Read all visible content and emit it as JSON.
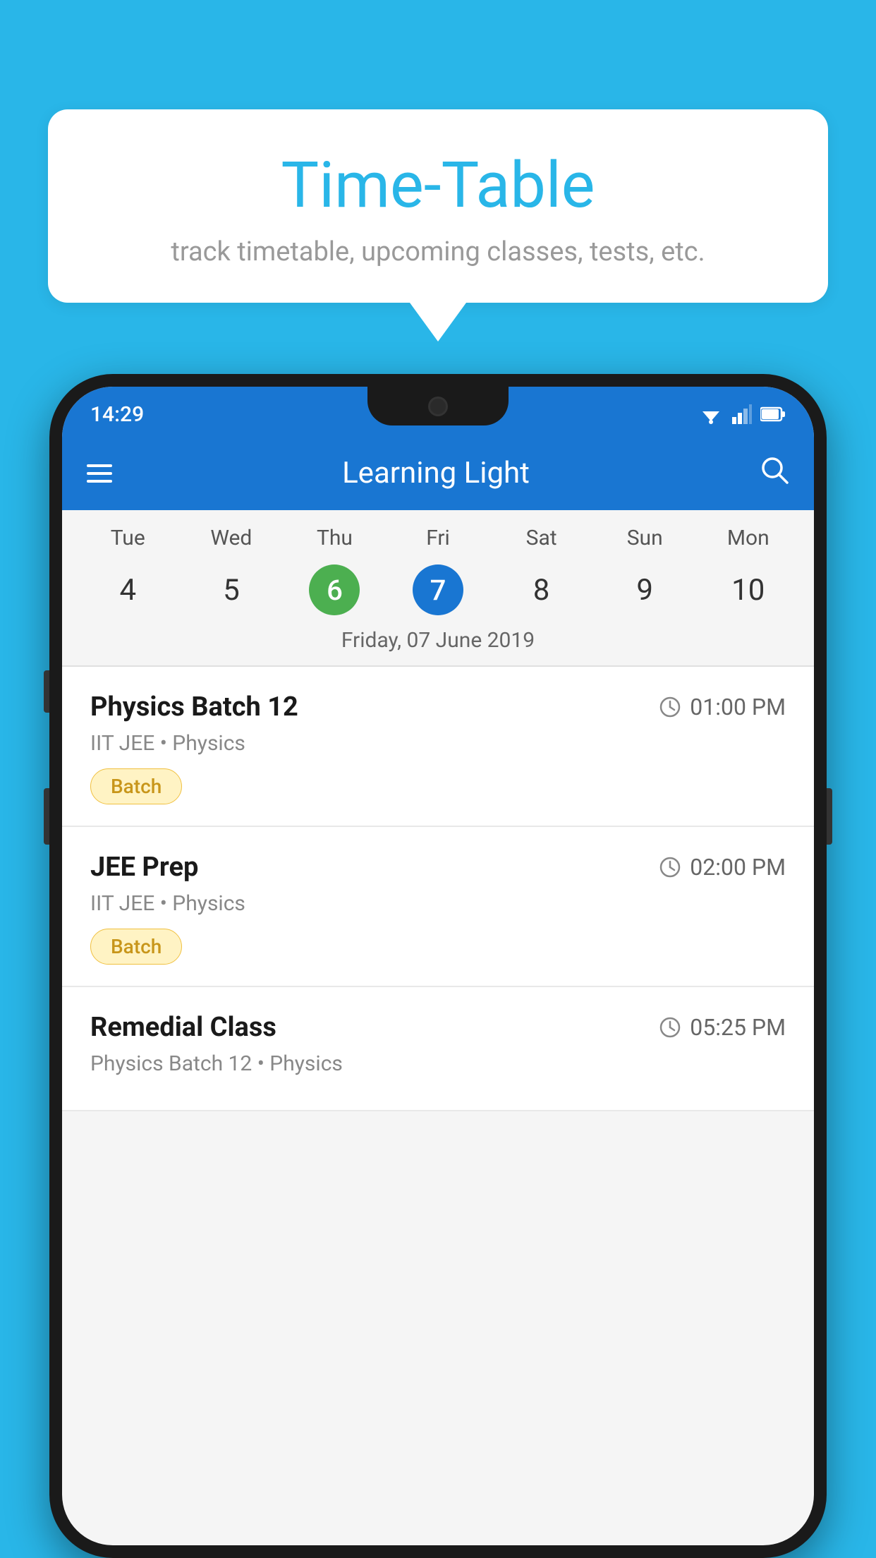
{
  "background_color": "#29B6E8",
  "bubble": {
    "title": "Time-Table",
    "subtitle": "track timetable, upcoming classes, tests, etc."
  },
  "phone": {
    "status_bar": {
      "time": "14:29"
    },
    "app_bar": {
      "title": "Learning Light"
    },
    "calendar": {
      "days": [
        "Tue",
        "Wed",
        "Thu",
        "Fri",
        "Sat",
        "Sun",
        "Mon"
      ],
      "dates": [
        "4",
        "5",
        "6",
        "7",
        "8",
        "9",
        "10"
      ],
      "today_index": 2,
      "selected_index": 3,
      "selected_label": "Friday, 07 June 2019"
    },
    "classes": [
      {
        "name": "Physics Batch 12",
        "time": "01:00 PM",
        "subtitle": "IIT JEE • Physics",
        "tag": "Batch"
      },
      {
        "name": "JEE Prep",
        "time": "02:00 PM",
        "subtitle": "IIT JEE • Physics",
        "tag": "Batch"
      },
      {
        "name": "Remedial Class",
        "time": "05:25 PM",
        "subtitle": "Physics Batch 12 • Physics",
        "tag": null
      }
    ]
  }
}
